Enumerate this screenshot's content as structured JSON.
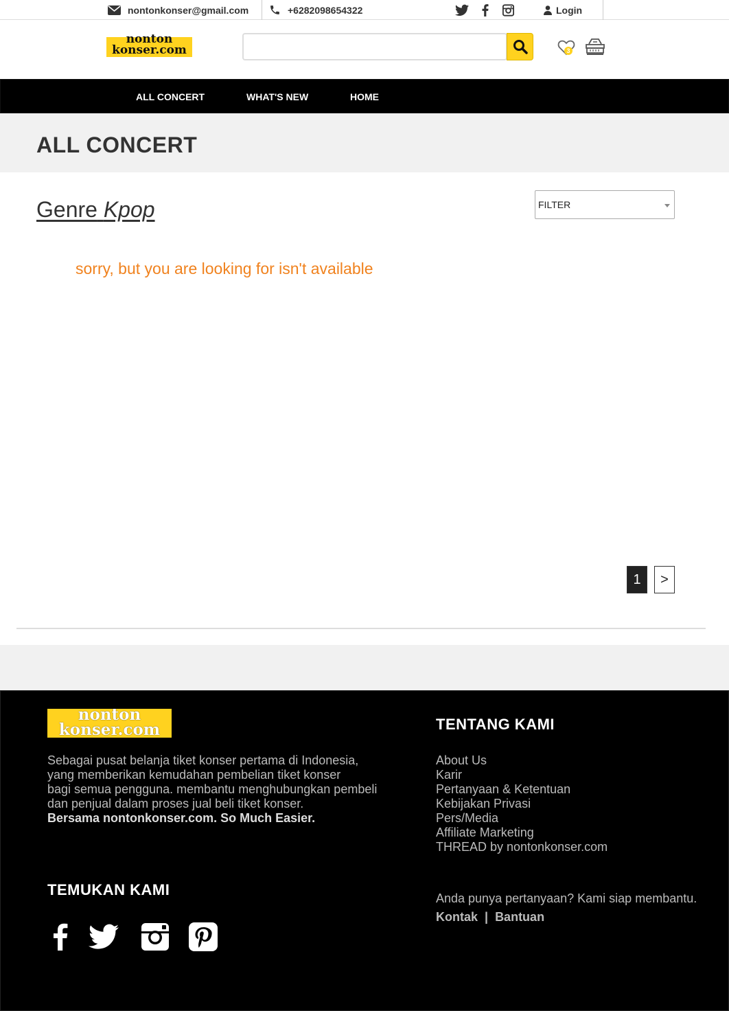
{
  "topbar": {
    "email": "nontonkonser@gmail.com",
    "phone": "+6282098654322",
    "login": "Login",
    "social_icons": [
      "twitter-icon",
      "facebook-icon",
      "instagram-icon"
    ]
  },
  "header": {
    "logo_line1": "nonton",
    "logo_line2": "konser.com",
    "search_placeholder": "",
    "wishlist_count": "3"
  },
  "nav": {
    "items": [
      "ALL CONCERT",
      "WHAT'S NEW",
      "HOME"
    ]
  },
  "page": {
    "title": "ALL CONCERT",
    "genre_prefix": "Genre",
    "genre_value": "Kpop",
    "filter_label": "FILTER",
    "empty_message": "sorry, but you are looking for isn't available",
    "pagination": {
      "current": "1",
      "next": ">"
    }
  },
  "footer": {
    "logo_line1": "nonton",
    "logo_line2": "konser.com",
    "about_lines": [
      "Sebagai pusat belanja tiket konser pertama di Indonesia,",
      "yang memberikan kemudahan pembelian tiket konser",
      "bagi semua pengguna. membantu menghubungkan pembeli",
      "dan penjual dalam proses jual beli tiket konser."
    ],
    "tagline": "Bersama nontonkonser.com. So Much Easier.",
    "find_us_heading": "TEMUKAN KAMI",
    "about_heading": "TENTANG KAMI",
    "links": [
      "About Us",
      "Karir",
      "Pertanyaan & Ketentuan",
      "Kebijakan Privasi",
      "Pers/Media",
      "Affiliate Marketing",
      "THREAD by nontonkonser.com"
    ],
    "question": "Anda punya pertanyaan? Kami siap membantu.",
    "contact": "Kontak",
    "separator": "|",
    "help": "Bantuan",
    "social_icons": [
      "facebook-icon",
      "twitter-icon",
      "instagram-icon",
      "pinterest-icon"
    ]
  }
}
